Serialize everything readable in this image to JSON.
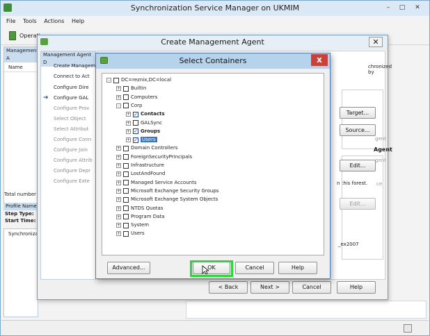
{
  "main": {
    "title": "Synchronization Service Manager on UKMIM",
    "menu": [
      "File",
      "Tools",
      "Actions",
      "Help"
    ],
    "toolbar_operations": "Operati",
    "left_panel_header": "Management A",
    "col_name": "Name",
    "total": "Total number",
    "profile_name": "Profile Name",
    "step_type": "Step Type:",
    "start_time": "Start Time:",
    "sync_item": "Synchronizatio",
    "win_min": "–",
    "win_max": "□",
    "win_close": "✕"
  },
  "cma": {
    "title": "Create Management Agent",
    "close": "✕",
    "left_header": "Management Agent D",
    "steps": [
      {
        "label": "Create Managem",
        "enabled": true
      },
      {
        "label": "Connect to Act",
        "enabled": true
      },
      {
        "label": "Configure Dire",
        "enabled": true
      },
      {
        "label": "Configure GAL",
        "enabled": true,
        "current": true
      },
      {
        "label": "Configure Prov",
        "enabled": false
      },
      {
        "label": "Select Object",
        "enabled": false
      },
      {
        "label": "Select Attribut",
        "enabled": false
      },
      {
        "label": "Configure Conn",
        "enabled": false
      },
      {
        "label": "Configure Join",
        "enabled": false
      },
      {
        "label": "Configure Attrib",
        "enabled": false
      },
      {
        "label": "Configure Depr",
        "enabled": false
      },
      {
        "label": "Configure Exte",
        "enabled": false
      }
    ],
    "right_text": {
      "synchronized_by": "chronized by",
      "agent1": "gent",
      "agent2": "Agent",
      "agent3": "gent",
      "ce": "ce",
      "in_forest": "n this forest.",
      "ex2007": "_ex2007"
    },
    "target_btn": "Target...",
    "source_btn": "Source...",
    "edit_btn1": "Edit...",
    "edit_btn2": "Edit...",
    "back_btn": "< Back",
    "next_btn": "Next >",
    "cancel_btn": "Cancel",
    "help_btn": "Help"
  },
  "select": {
    "title": "Select Containers",
    "close": "x",
    "tree": [
      {
        "label": "DC=reznix,DC=local",
        "indent": 0,
        "expander": "-",
        "checked": false
      },
      {
        "label": "Builtin",
        "indent": 1,
        "expander": "+",
        "checked": false
      },
      {
        "label": "Computers",
        "indent": 1,
        "expander": "+",
        "checked": false
      },
      {
        "label": "Corp",
        "indent": 1,
        "expander": "-",
        "checked": false
      },
      {
        "label": "Contacts",
        "indent": 2,
        "expander": "+",
        "checked": true
      },
      {
        "label": "GALSync",
        "indent": 2,
        "expander": "+",
        "checked": false
      },
      {
        "label": "Groups",
        "indent": 2,
        "expander": "+",
        "checked": true
      },
      {
        "label": "Users",
        "indent": 2,
        "expander": "+",
        "checked": true,
        "selected": true
      },
      {
        "label": "Domain Controllers",
        "indent": 1,
        "expander": "+",
        "checked": false
      },
      {
        "label": "ForeignSecurityPrincipals",
        "indent": 1,
        "expander": "+",
        "checked": false
      },
      {
        "label": "Infrastructure",
        "indent": 1,
        "expander": "+",
        "checked": false
      },
      {
        "label": "LostAndFound",
        "indent": 1,
        "expander": "+",
        "checked": false
      },
      {
        "label": "Managed Service Accounts",
        "indent": 1,
        "expander": "+",
        "checked": false
      },
      {
        "label": "Microsoft Exchange Security Groups",
        "indent": 1,
        "expander": "+",
        "checked": false
      },
      {
        "label": "Microsoft Exchange System Objects",
        "indent": 1,
        "expander": "+",
        "checked": false
      },
      {
        "label": "NTDS Quotas",
        "indent": 1,
        "expander": "+",
        "checked": false
      },
      {
        "label": "Program Data",
        "indent": 1,
        "expander": "+",
        "checked": false
      },
      {
        "label": "System",
        "indent": 1,
        "expander": "+",
        "checked": false
      },
      {
        "label": "Users",
        "indent": 1,
        "expander": "+",
        "checked": false
      }
    ],
    "advanced_btn": "Advanced...",
    "ok_btn": "OK",
    "cancel_btn": "Cancel",
    "help_btn": "Help",
    "highlight_color": "#2bd63a"
  }
}
